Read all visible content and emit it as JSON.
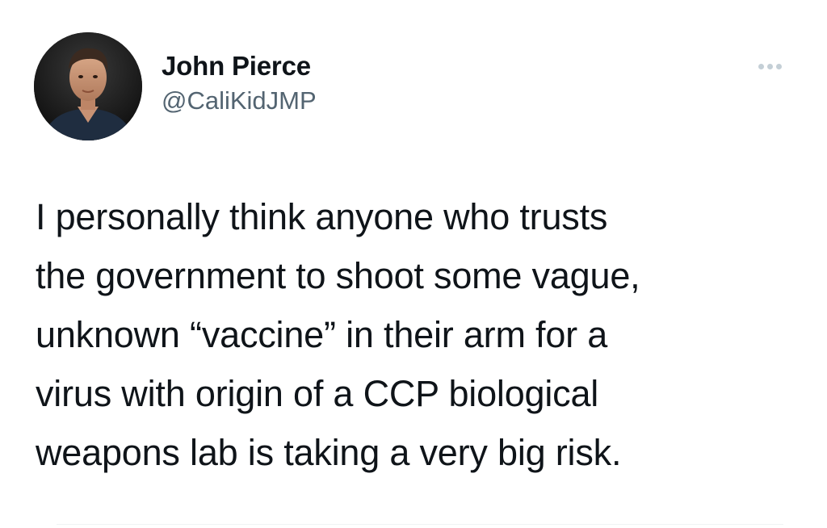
{
  "author": {
    "display_name": "John Pierce",
    "handle": "@CaliKidJMP",
    "avatar_icon": "profile-photo"
  },
  "menu": {
    "more_icon": "more-horizontal-icon"
  },
  "tweet": {
    "text": "I personally think anyone who trusts\nthe government to shoot some vague,\nunknown “vaccine” in their arm for a\nvirus with origin of a CCP biological\nweapons lab is taking a very big risk."
  },
  "colors": {
    "text_primary": "#0f1419",
    "text_secondary": "#536471",
    "more_dots": "#c4cfd6",
    "background": "#ffffff"
  }
}
